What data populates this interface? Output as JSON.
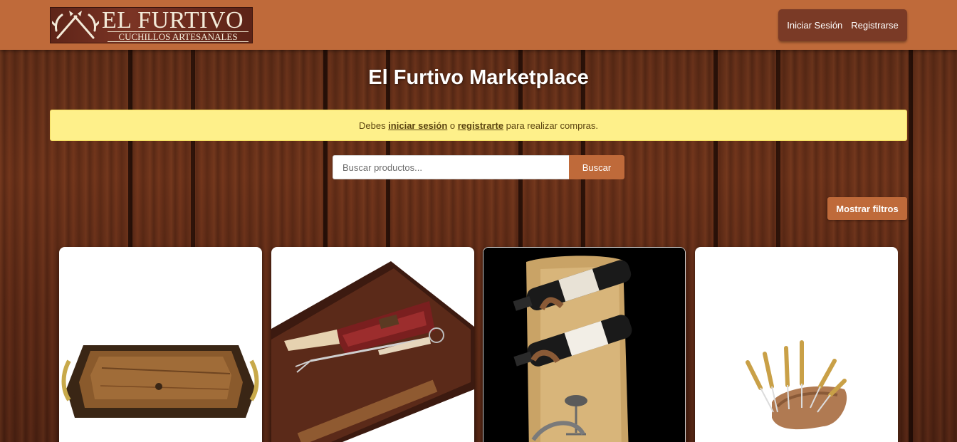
{
  "header": {
    "logo": {
      "title": "EL FURTIVO",
      "subtitle": "CUCHILLOS ARTESANALES"
    },
    "auth": {
      "login_label": "Iniciar Sesión",
      "register_label": "Registrarse"
    }
  },
  "main": {
    "title": "El Furtivo Marketplace",
    "notice": {
      "prefix": "Debes ",
      "login_link": "iniciar sesión",
      "middle": " o ",
      "register_link": "registrarte",
      "suffix": " para realizar compras."
    },
    "search": {
      "placeholder": "Buscar productos...",
      "value": "",
      "button_label": "Buscar"
    },
    "filters_button_label": "Mostrar filtros"
  },
  "products": [
    {
      "image": "wooden-tray-with-handles"
    },
    {
      "image": "knife-and-fork-on-cutting-board"
    },
    {
      "image": "wall-wine-rack"
    },
    {
      "image": "fondue-fork-set-on-antler-stand"
    }
  ],
  "colors": {
    "header": "#bf6a3a",
    "auth_box": "#7a3a26",
    "notice_bg": "#fef08a",
    "accent": "#bf6a3a"
  }
}
